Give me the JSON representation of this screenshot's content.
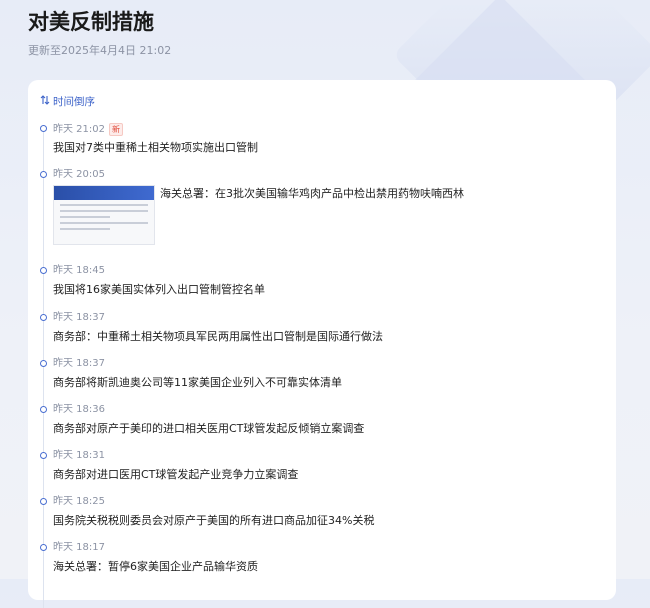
{
  "page": {
    "title": "对美反制措施",
    "updated": "更新至2025年4月4日 21:02"
  },
  "sort": {
    "label": "时间倒序"
  },
  "timeline": [
    {
      "time": "昨天 21:02",
      "badge": "新",
      "text": "我国对7类中重稀土相关物项实施出口管制"
    },
    {
      "time": "昨天 20:05",
      "text": "海关总署：在3批次美国输华鸡肉产品中检出禁用药物呋喃西林",
      "has_thumbnail": true
    },
    {
      "time": "昨天 18:45",
      "text": "我国将16家美国实体列入出口管制管控名单"
    },
    {
      "time": "昨天 18:37",
      "text": "商务部：中重稀土相关物项具军民两用属性出口管制是国际通行做法"
    },
    {
      "time": "昨天 18:37",
      "text": "商务部将斯凯迪奥公司等11家美国企业列入不可靠实体清单"
    },
    {
      "time": "昨天 18:36",
      "text": "商务部对原产于美印的进口相关医用CT球管发起反倾销立案调查"
    },
    {
      "time": "昨天 18:31",
      "text": "商务部对进口医用CT球管发起产业竞争力立案调查"
    },
    {
      "time": "昨天 18:25",
      "text": "国务院关税税则委员会对原产于美国的所有进口商品加征34%关税"
    },
    {
      "time": "昨天 18:17",
      "text": "海关总署：暂停6家美国企业产品输华资质"
    }
  ],
  "colors": {
    "accent": "#3d63c9",
    "badge": "#e04a3a"
  }
}
